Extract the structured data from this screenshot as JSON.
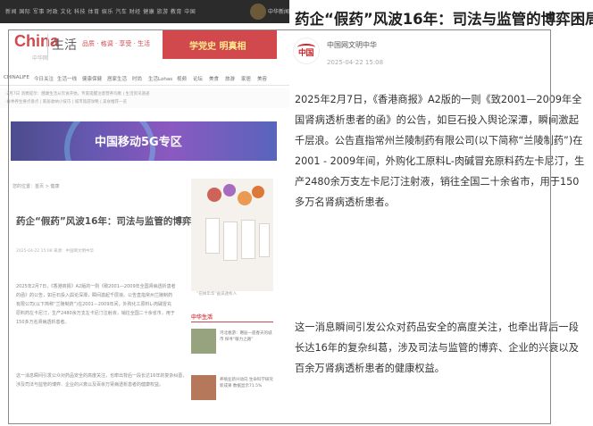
{
  "web_page": {
    "topbar_links": "新闻  国际  军事  时政  文化  科技  体育  娱乐  汽车  财经  健康  旅游  教育  中国",
    "brand_name": "中华新闻",
    "logo_text": "China",
    "logo_sub": "中华网",
    "channel_name": "生活",
    "slogan": "品质 · 格调 · 享受 · 生活",
    "party_banner": "学党史 明真相",
    "nav": [
      "CHINALIFE",
      "今日关注",
      "生活一线",
      "健康保健",
      "居家生活",
      "时尚",
      "生活Lohas",
      "视频",
      "论坛",
      "美食",
      "旅游",
      "家居",
      "美容"
    ],
    "ticker_lines": [
      "·2月7日 消费提示：健康生活从饮食开始，专家提醒注意营养均衡 | 生活资讯速递",
      "·春季养生要点盘点 | 家居收纳小技巧 | 城市旅游攻略 | 美食推荐一览"
    ],
    "banner_text": "中国移动5G专区",
    "breadcrumb": "您的位置：首页 > 健康",
    "article_title": "药企“假药”风波16年：司法与监管的博弈困局",
    "article_meta": "2025-04-22 15:08    来源：中国网文明中华",
    "article_paragraphs": [
      [
        "2025年2月7日，《香港商报》A2版的一则《致2001—2009年全国肾病透析患者",
        "的函》的公告，如巨石投入舆论深潭，瞬间激起千层浪。公告直指常州兰陵制药",
        "有限公司(以下简称“兰陵制药”)在2001－2009年间，外购化工原料L-肉碱冒充",
        "原料药左卡尼汀，生产2480余万支左卡尼汀注射液，销往全国二十余省市，用于",
        "150多万名肾病透析患者。"
      ],
      [
        "这一消息瞬间引发公众对药品安全的高度关注，也牵出背后一段长达16年的复杂纠葛，",
        "涉及司法与监管的博弈、企业的兴衰以及百余万肾病透析患者的健康权益。"
      ]
    ],
    "photo_caption": "“花样年华”画说透析人",
    "side_heading": "中华生活",
    "side_news": [
      "河北春游：邂逅一座春天的城市 探寻“暖力之路”",
      "养殖业新兴动向 生命科学研究新成果 数据显示71.5%"
    ]
  },
  "article": {
    "headline": "药企“假药”风波16年：司法与监管的博弈困局",
    "author_name": "中国网文明中华",
    "publish_time": "2025-04-22 15:08",
    "avatar_mark": "中国",
    "paragraphs": [
      [
        "2025年2月7日，《香港商报》A2版的一则《致2001—2009年全",
        "国肾病透析患者的函》的公告，如巨石投入舆论深潭，瞬间激起",
        "千层浪。公告直指常州兰陵制药有限公司(以下简称“兰陵制药”)在",
        "2001 - 2009年间，外购化工原料L-肉碱冒充原料药左卡尼汀，生",
        "产2480余万支左卡尼汀注射液，销往全国二十余省市，用于150",
        "多万名肾病透析患者。"
      ],
      [
        "这一消息瞬间引发公众对药品安全的高度关注，也牵出背后一段",
        "长达16年的复杂纠葛，涉及司法与监管的博弈、企业的兴衰以及",
        "百余万肾病透析患者的健康权益。"
      ]
    ]
  },
  "colors": {
    "brand_red": "#c4161c",
    "text_dark": "#333333",
    "frame_gray": "#8a8a8a"
  }
}
